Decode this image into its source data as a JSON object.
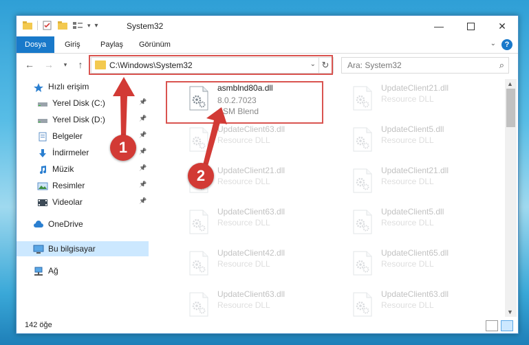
{
  "window": {
    "title": "System32"
  },
  "ribbon": {
    "tabs": [
      "Dosya",
      "Giriş",
      "Paylaş",
      "Görünüm"
    ],
    "active_tab": "Dosya",
    "help": "?"
  },
  "address": {
    "path": "C:\\Windows\\System32",
    "search_placeholder": "Ara: System32"
  },
  "sidebar": {
    "items": [
      {
        "label": "Hızlı erişim",
        "icon": "star-icon"
      },
      {
        "label": "Yerel Disk (C:)",
        "icon": "drive-icon",
        "pinned": true
      },
      {
        "label": "Yerel Disk (D:)",
        "icon": "drive-icon",
        "pinned": true
      },
      {
        "label": "Belgeler",
        "icon": "documents-icon",
        "pinned": true
      },
      {
        "label": "İndirmeler",
        "icon": "download-icon",
        "pinned": true
      },
      {
        "label": "Müzik",
        "icon": "music-icon",
        "pinned": true
      },
      {
        "label": "Resimler",
        "icon": "pictures-icon",
        "pinned": true
      },
      {
        "label": "Videolar",
        "icon": "videos-icon",
        "pinned": true
      },
      {
        "label": "OneDrive",
        "icon": "cloud-icon"
      },
      {
        "label": "Bu bilgisayar",
        "icon": "computer-icon",
        "selected": true
      },
      {
        "label": "Ağ",
        "icon": "network-icon"
      }
    ]
  },
  "files": [
    {
      "name": "asmblnd80a.dll",
      "version": "8.0.2.7023",
      "desc": "ASM Blend",
      "faded": false
    },
    {
      "name": "UpdateClient21.dll",
      "desc": "Resource DLL",
      "faded": true
    },
    {
      "name": "UpdateClient63.dll",
      "desc": "Resource DLL",
      "faded": true
    },
    {
      "name": "UpdateClient5.dll",
      "desc": "Resource DLL",
      "faded": true
    },
    {
      "name": "UpdateClient21.dll",
      "desc": "Resource DLL",
      "faded": true
    },
    {
      "name": "UpdateClient21.dll",
      "desc": "Resource DLL",
      "faded": true
    },
    {
      "name": "UpdateClient63.dll",
      "desc": "Resource DLL",
      "faded": true
    },
    {
      "name": "UpdateClient5.dll",
      "desc": "Resource DLL",
      "faded": true
    },
    {
      "name": "UpdateClient42.dll",
      "desc": "Resource DLL",
      "faded": true
    },
    {
      "name": "UpdateClient65.dll",
      "desc": "Resource DLL",
      "faded": true
    },
    {
      "name": "UpdateClient63.dll",
      "desc": "Resource DLL",
      "faded": true
    },
    {
      "name": "UpdateClient63.dll",
      "desc": "Resource DLL",
      "faded": true
    }
  ],
  "status": {
    "count": "142 öğe"
  },
  "annotations": {
    "badge1": "1",
    "badge2": "2",
    "color": "#d23a35"
  }
}
